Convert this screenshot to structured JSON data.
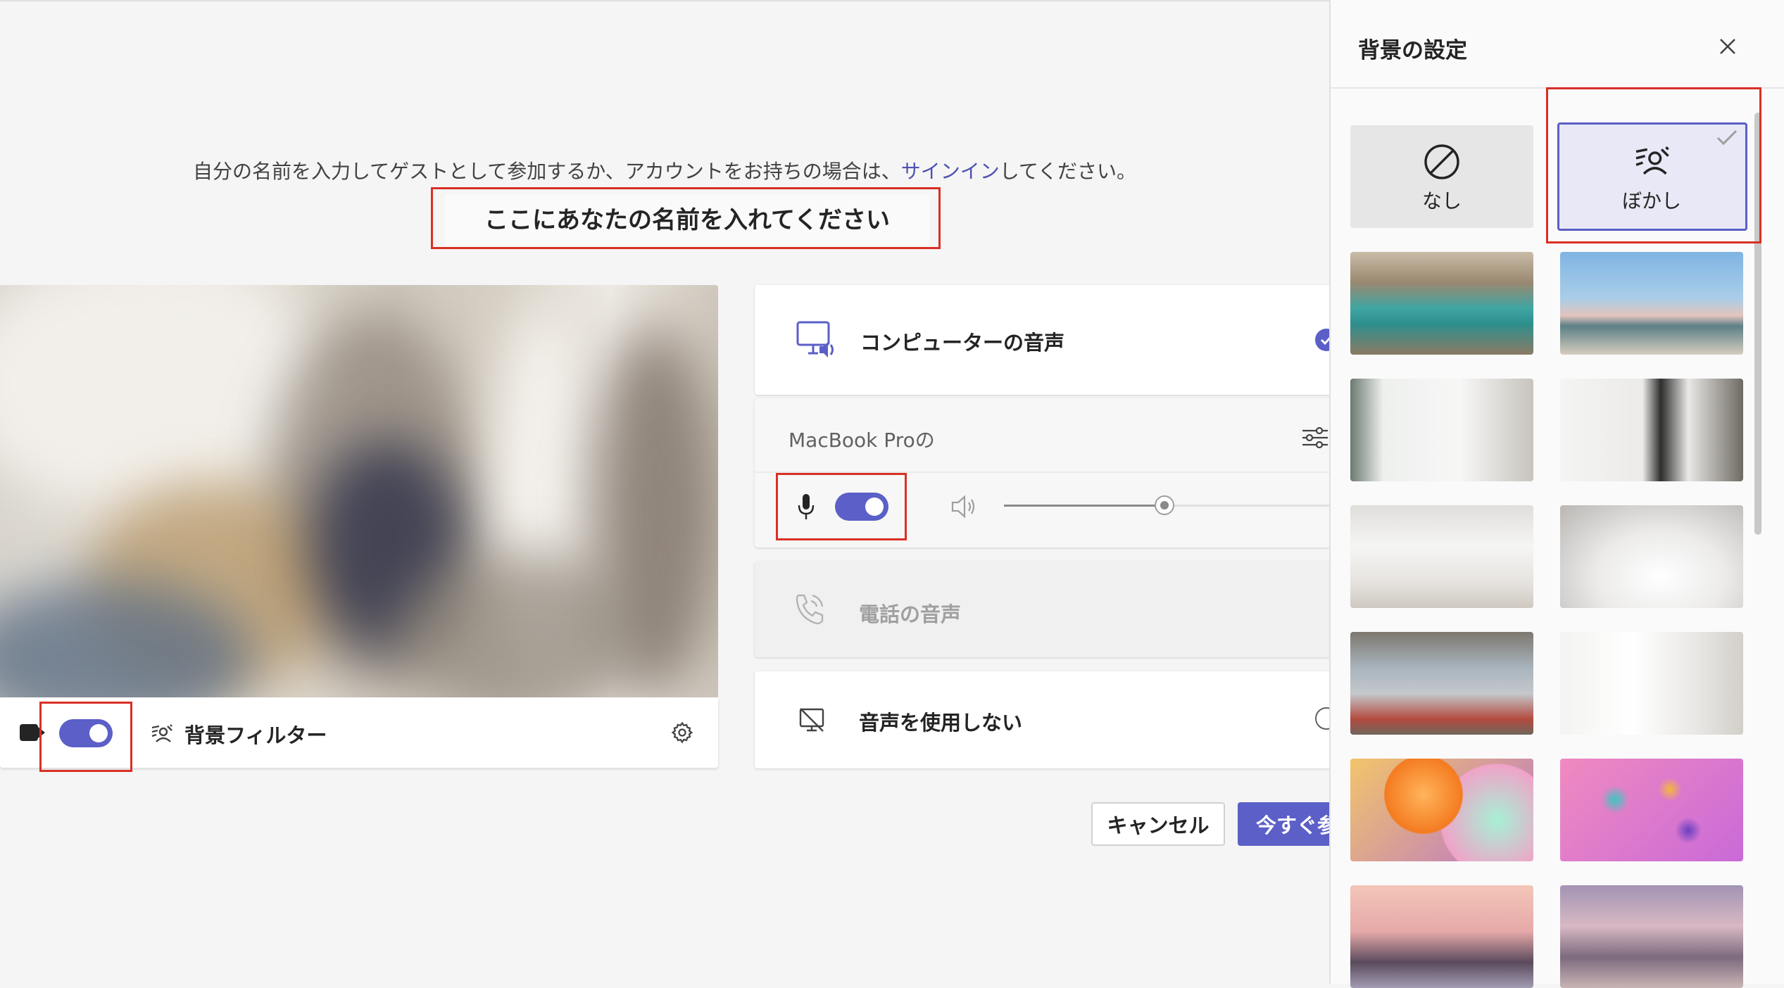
{
  "join": {
    "prompt_prefix": "自分の名前を入力してゲストとして参加するか、アカウントをお持ちの場合は、",
    "prompt_link": "サインイン",
    "prompt_suffix": "してください。",
    "name_placeholder": "ここにあなたの名前を入れてください"
  },
  "preview": {
    "camera_on": true,
    "background_filter_label": "背景フィルター"
  },
  "audio": {
    "computer_audio_label": "コンピューターの音声",
    "device_label": "MacBook Proの",
    "mic_on": true,
    "speaker_volume_fraction": 0.5,
    "phone_audio_label": "電話の音声",
    "no_audio_label": "音声を使用しない",
    "selected": "computer"
  },
  "buttons": {
    "cancel_label": "キャンセル",
    "join_label": "今すぐ参"
  },
  "background_panel": {
    "title": "背景の設定",
    "none_label": "なし",
    "blur_label": "ぼかし",
    "selected": "blur",
    "accent": "#5b5fc7"
  }
}
